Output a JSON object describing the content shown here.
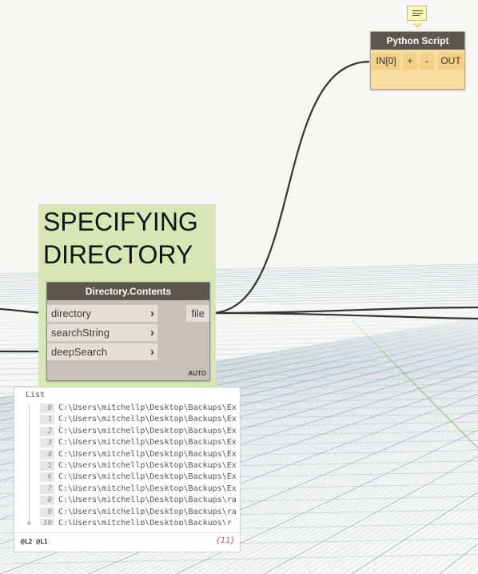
{
  "group": {
    "title": "SPECIFYING\nDIRECTORY"
  },
  "directory_node": {
    "title": "Directory.Contents",
    "inputs": [
      "directory",
      "searchString",
      "deepSearch"
    ],
    "output": "file",
    "lacing": "AUTO"
  },
  "python_node": {
    "title": "Python Script",
    "input": "IN[0]",
    "add": "+",
    "remove": "-",
    "output": "OUT"
  },
  "preview": {
    "title": "List",
    "items": [
      {
        "index": "0",
        "path": "C:\\Users\\mitchellp\\Desktop\\Backups\\Ex"
      },
      {
        "index": "1",
        "path": "C:\\Users\\mitchellp\\Desktop\\Backups\\Ex"
      },
      {
        "index": "2",
        "path": "C:\\Users\\mitchellp\\Desktop\\Backups\\Ex"
      },
      {
        "index": "3",
        "path": "C:\\Users\\mitchellp\\Desktop\\Backups\\Ex"
      },
      {
        "index": "4",
        "path": "C:\\Users\\mitchellp\\Desktop\\Backups\\Ex"
      },
      {
        "index": "5",
        "path": "C:\\Users\\mitchellp\\Desktop\\Backups\\Ex"
      },
      {
        "index": "6",
        "path": "C:\\Users\\mitchellp\\Desktop\\Backups\\Ex"
      },
      {
        "index": "7",
        "path": "C:\\Users\\mitchellp\\Desktop\\Backups\\Ex"
      },
      {
        "index": "8",
        "path": "C:\\Users\\mitchellp\\Desktop\\Backups\\ra"
      },
      {
        "index": "9",
        "path": "C:\\Users\\mitchellp\\Desktop\\Backups\\ra"
      },
      {
        "index": "10",
        "path": "C:\\Users\\mitchellp\\Desktop\\Backups\\r"
      }
    ],
    "levels": "@L2 @L1",
    "count": "{11}"
  },
  "colors": {
    "node_header": "#5b574f",
    "node_body": "#c7c1b7",
    "python_body": "#f9dca0",
    "group_fill": "#d8e6b3",
    "wire": "#333333"
  },
  "icons": [
    "note-icon",
    "chevron-right-icon"
  ]
}
